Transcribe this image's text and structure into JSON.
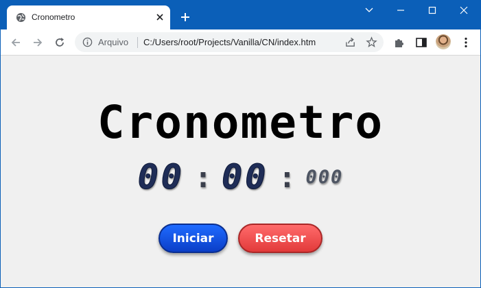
{
  "browser": {
    "tab_title": "Cronometro",
    "address": {
      "scheme_label": "Arquivo",
      "url": "C:/Users/root/Projects/Vanilla/CN/index.htm"
    }
  },
  "page": {
    "heading": "Cronometro",
    "timer": {
      "minutes": "00",
      "seconds": "00",
      "separator": ":",
      "milliseconds": "000"
    },
    "buttons": {
      "start_label": "Iniciar",
      "reset_label": "Resetar"
    }
  },
  "colors": {
    "frame": "#0b5fb8",
    "start_button": "#1f6bff",
    "reset_button": "#ff6b6b",
    "digits": "#1f2d57"
  }
}
